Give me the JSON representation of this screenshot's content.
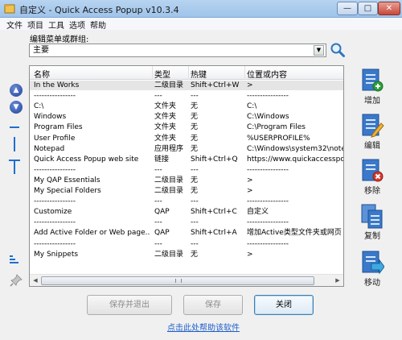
{
  "window": {
    "title": "自定义 - Quick Access Popup v10.3.4",
    "min_glyph": "—",
    "max_glyph": "□",
    "close_glyph": "✕"
  },
  "menubar": [
    "文件",
    "项目",
    "工具",
    "选项",
    "帮助"
  ],
  "group": {
    "label": "编辑菜单或群组:",
    "selected": "主要"
  },
  "list": {
    "columns": [
      "名称",
      "类型",
      "热键",
      "位置或内容"
    ],
    "rows": [
      {
        "name": "In the Works",
        "type": "二级目录",
        "hotkey": "Shift+Ctrl+W",
        "location": ">"
      },
      {
        "name": "----------------",
        "type": "---",
        "hotkey": "---",
        "location": "----------------"
      },
      {
        "name": "C:\\",
        "type": "文件夹",
        "hotkey": "无",
        "location": "C:\\"
      },
      {
        "name": "Windows",
        "type": "文件夹",
        "hotkey": "无",
        "location": "C:\\Windows"
      },
      {
        "name": "Program Files",
        "type": "文件夹",
        "hotkey": "无",
        "location": "C:\\Program Files"
      },
      {
        "name": "User Profile",
        "type": "文件夹",
        "hotkey": "无",
        "location": "%USERPROFILE%"
      },
      {
        "name": "Notepad",
        "type": "应用程序",
        "hotkey": "无",
        "location": "C:\\Windows\\system32\\note"
      },
      {
        "name": "Quick Access Popup web site",
        "type": "链接",
        "hotkey": "Shift+Ctrl+Q",
        "location": "https://www.quickaccesspo"
      },
      {
        "name": "----------------",
        "type": "---",
        "hotkey": "---",
        "location": "----------------"
      },
      {
        "name": "My QAP Essentials",
        "type": "二级目录",
        "hotkey": "无",
        "location": ">"
      },
      {
        "name": "My Special Folders",
        "type": "二级目录",
        "hotkey": "无",
        "location": ">"
      },
      {
        "name": "----------------",
        "type": "---",
        "hotkey": "---",
        "location": "----------------"
      },
      {
        "name": "Customize",
        "type": "QAP",
        "hotkey": "Shift+Ctrl+C",
        "location": "自定义"
      },
      {
        "name": "----------------",
        "type": "---",
        "hotkey": "---",
        "location": "----------------"
      },
      {
        "name": "Add Active Folder or Web page...",
        "type": "QAP",
        "hotkey": "Shift+Ctrl+A",
        "location": "增加Active类型文件夹或网页"
      },
      {
        "name": "----------------",
        "type": "---",
        "hotkey": "---",
        "location": "----------------"
      },
      {
        "name": "My Snippets",
        "type": "二级目录",
        "hotkey": "无",
        "location": ">"
      }
    ],
    "scroll_left": "◀",
    "scroll_right": "▶"
  },
  "side_buttons": {
    "add": "增加",
    "edit": "编辑",
    "remove": "移除",
    "copy": "复制",
    "move": "移动"
  },
  "left_tools": {
    "up": "▲",
    "down": "▼"
  },
  "buttons": {
    "save_exit": "保存并退出",
    "save": "保存",
    "close": "关闭"
  },
  "help_link": "点击此处帮助该软件",
  "colors": {
    "accent": "#1d6fd1",
    "link": "#1c5fc9",
    "selected_row": "#e5e5e5"
  }
}
